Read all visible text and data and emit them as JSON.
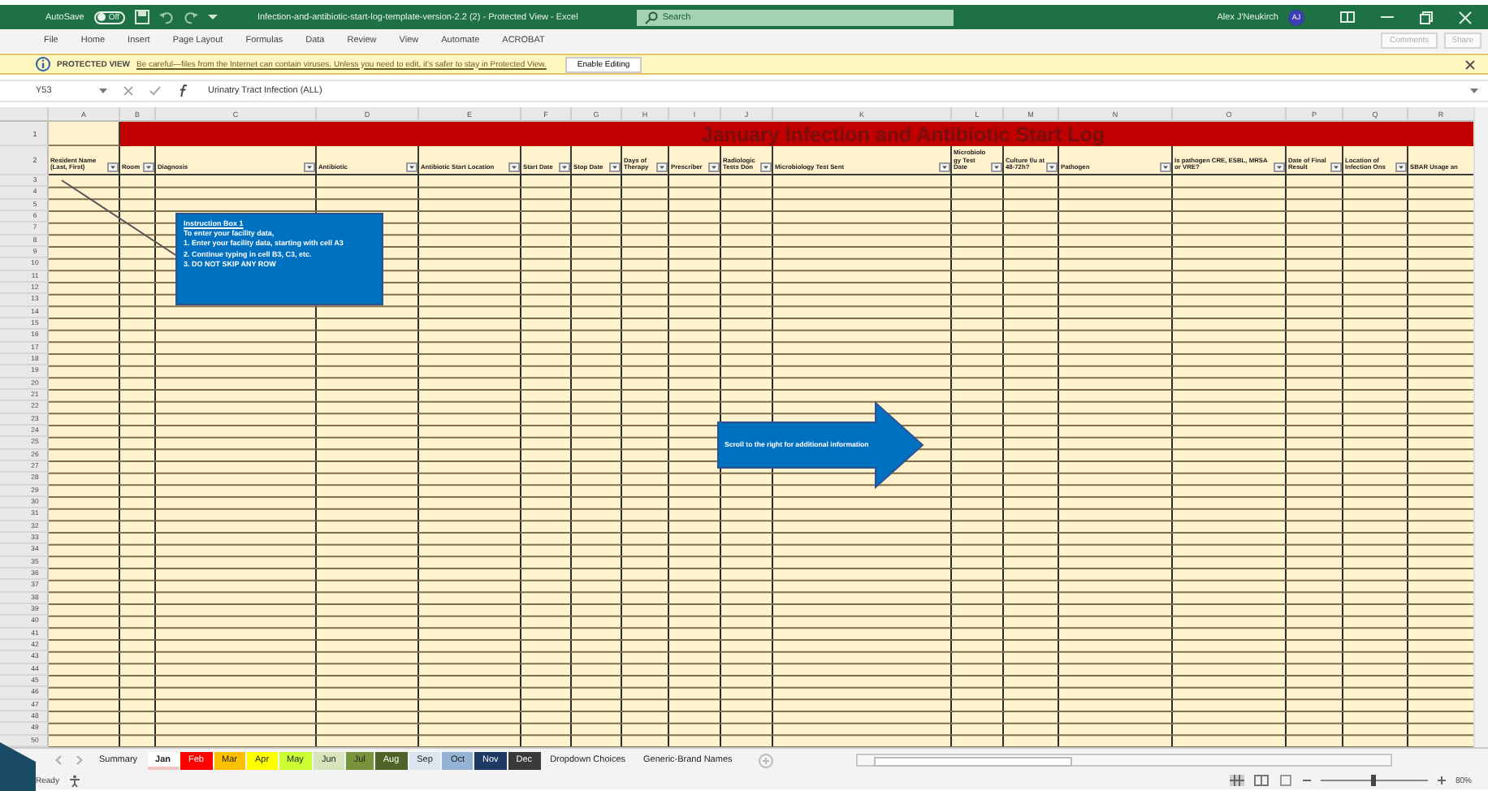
{
  "title_bar": {
    "autosave_label": "AutoSave",
    "autosave_state": "Off",
    "autosave_on": false,
    "title": "Infection-and-antibiotic-start-log-template-version-2.2 (2) - Protected View - Excel",
    "search_placeholder": "Search",
    "user_name": "Alex J'Neukirch",
    "user_initials": "AJ"
  },
  "menu": [
    "File",
    "Home",
    "Insert",
    "Page Layout",
    "Formulas",
    "Data",
    "Review",
    "View",
    "Automate",
    "ACROBAT"
  ],
  "menu_buttons": [
    {
      "label": "Comments",
      "disabled": true
    },
    {
      "label": "Share",
      "disabled": true
    }
  ],
  "protected_view": {
    "label": "PROTECTED VIEW",
    "message": "Be careful—files from the Internet can contain viruses. Unless you need to edit, it's safer to stay in Protected View.",
    "button": "Enable Editing"
  },
  "formula_bar": {
    "cell": "Y53",
    "formula": "Urinatry Tract Infection (ALL)"
  },
  "sheet": {
    "title": "January Infection and Antibiotic Start Log",
    "columns": [
      {
        "letter": "A",
        "header": "Resident Name (Last, First)",
        "filter": true
      },
      {
        "letter": "B",
        "header": "Room",
        "filter": true
      },
      {
        "letter": "C",
        "header": "Diagnosis",
        "filter": true
      },
      {
        "letter": "D",
        "header": "Antibiotic",
        "filter": true
      },
      {
        "letter": "E",
        "header": "Antibiotic Start Location",
        "filter": true
      },
      {
        "letter": "F",
        "header": "Start Date",
        "filter": true
      },
      {
        "letter": "G",
        "header": "Stop Date",
        "filter": true
      },
      {
        "letter": "H",
        "header": "Days of Therapy",
        "filter": true
      },
      {
        "letter": "I",
        "header": "Prescriber",
        "filter": true
      },
      {
        "letter": "J",
        "header": "Radiologic Tests Don",
        "filter": true
      },
      {
        "letter": "K",
        "header": "Microbiology Test Sent",
        "filter": true
      },
      {
        "letter": "L",
        "header": "Microbiology Test Date",
        "filter": true
      },
      {
        "letter": "M",
        "header": "Culture f/u at 48-72h?",
        "filter": true
      },
      {
        "letter": "N",
        "header": "Pathogen",
        "filter": true
      },
      {
        "letter": "O",
        "header": "Is pathogen CRE, ESBL, MRSA or VRE?",
        "filter": true
      },
      {
        "letter": "P",
        "header": "Date of Final Result",
        "filter": true
      },
      {
        "letter": "Q",
        "header": "Location of Infection Ons",
        "filter": true
      },
      {
        "letter": "R",
        "header": "SBAR Usage an",
        "filter": false
      }
    ],
    "row_numbers": [
      "1",
      "2",
      "3",
      "4",
      "5",
      "6",
      "7",
      "8",
      "9",
      "10",
      "11",
      "12",
      "13",
      "14",
      "15",
      "16",
      "17",
      "18",
      "19",
      "20",
      "21",
      "22",
      "23",
      "24",
      "25",
      "26",
      "27",
      "28",
      "29",
      "30",
      "31",
      "32",
      "33",
      "34",
      "35",
      "36",
      "37",
      "38",
      "39",
      "40",
      "41",
      "42",
      "43",
      "44",
      "45",
      "46",
      "47",
      "48",
      "49",
      "50"
    ],
    "instruction_box": {
      "title": "Instruction Box 1",
      "lines": [
        "To enter your facility data,",
        "1. Enter your facility data, starting with cell A3",
        "2. Continue typing in cell B3, C3, etc.",
        "3. DO NOT SKIP ANY ROW"
      ]
    },
    "arrow_callout": "Scroll to the right for additional information"
  },
  "sheet_tabs": [
    {
      "label": "Summary",
      "color": "#f3f3f3",
      "selected": false
    },
    {
      "label": "Jan",
      "color": "#f2c4c4",
      "selected": true
    },
    {
      "label": "Feb",
      "color": "#ff0000",
      "selected": false
    },
    {
      "label": "Mar",
      "color": "#ffc000",
      "selected": false
    },
    {
      "label": "Apr",
      "color": "#ffff00",
      "selected": false
    },
    {
      "label": "May",
      "color": "#ccff33",
      "selected": false
    },
    {
      "label": "Jun",
      "color": "#d8e4bc",
      "selected": false
    },
    {
      "label": "Jul",
      "color": "#77933c",
      "selected": false
    },
    {
      "label": "Aug",
      "color": "#4f6228",
      "selected": false
    },
    {
      "label": "Sep",
      "color": "#dce6f1",
      "selected": false
    },
    {
      "label": "Oct",
      "color": "#95b3d7",
      "selected": false
    },
    {
      "label": "Nov",
      "color": "#1f3864",
      "selected": false
    },
    {
      "label": "Dec",
      "color": "#3a3a3a",
      "selected": false
    },
    {
      "label": "Dropdown Choices",
      "color": "#f3f3f3",
      "selected": false
    },
    {
      "label": "Generic-Brand Names",
      "color": "#f3f3f3",
      "selected": false
    }
  ],
  "status_bar": {
    "status": "Ready",
    "zoom": "80%",
    "level": 0.5
  }
}
